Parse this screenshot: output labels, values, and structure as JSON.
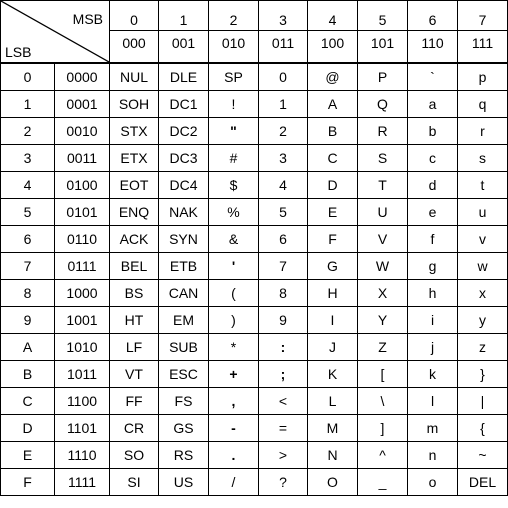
{
  "corner": {
    "msb_label": "MSB",
    "lsb_label": "LSB"
  },
  "columns": [
    {
      "hex": "0",
      "bin": "000"
    },
    {
      "hex": "1",
      "bin": "001"
    },
    {
      "hex": "2",
      "bin": "010"
    },
    {
      "hex": "3",
      "bin": "011"
    },
    {
      "hex": "4",
      "bin": "100"
    },
    {
      "hex": "5",
      "bin": "101"
    },
    {
      "hex": "6",
      "bin": "110"
    },
    {
      "hex": "7",
      "bin": "111"
    }
  ],
  "rows": [
    {
      "hex": "0",
      "bin": "0000",
      "cells": [
        "NUL",
        "DLE",
        "SP",
        "0",
        "@",
        "P",
        "`",
        "p"
      ]
    },
    {
      "hex": "1",
      "bin": "0001",
      "cells": [
        "SOH",
        "DC1",
        "!",
        "1",
        "A",
        "Q",
        "a",
        "q"
      ]
    },
    {
      "hex": "2",
      "bin": "0010",
      "cells": [
        "STX",
        "DC2",
        "\"",
        "2",
        "B",
        "R",
        "b",
        "r"
      ]
    },
    {
      "hex": "3",
      "bin": "0011",
      "cells": [
        "ETX",
        "DC3",
        "#",
        "3",
        "C",
        "S",
        "c",
        "s"
      ]
    },
    {
      "hex": "4",
      "bin": "0100",
      "cells": [
        "EOT",
        "DC4",
        "$",
        "4",
        "D",
        "T",
        "d",
        "t"
      ]
    },
    {
      "hex": "5",
      "bin": "0101",
      "cells": [
        "ENQ",
        "NAK",
        "%",
        "5",
        "E",
        "U",
        "e",
        "u"
      ]
    },
    {
      "hex": "6",
      "bin": "0110",
      "cells": [
        "ACK",
        "SYN",
        "&",
        "6",
        "F",
        "V",
        "f",
        "v"
      ]
    },
    {
      "hex": "7",
      "bin": "0111",
      "cells": [
        "BEL",
        "ETB",
        "'",
        "7",
        "G",
        "W",
        "g",
        "w"
      ]
    },
    {
      "hex": "8",
      "bin": "1000",
      "cells": [
        "BS",
        "CAN",
        "(",
        "8",
        "H",
        "X",
        "h",
        "x"
      ]
    },
    {
      "hex": "9",
      "bin": "1001",
      "cells": [
        "HT",
        "EM",
        ")",
        "9",
        "I",
        "Y",
        "i",
        "y"
      ]
    },
    {
      "hex": "A",
      "bin": "1010",
      "cells": [
        "LF",
        "SUB",
        "*",
        ":",
        "J",
        "Z",
        "j",
        "z"
      ]
    },
    {
      "hex": "B",
      "bin": "1011",
      "cells": [
        "VT",
        "ESC",
        "+",
        ";",
        "K",
        "[",
        "k",
        "}"
      ]
    },
    {
      "hex": "C",
      "bin": "1100",
      "cells": [
        "FF",
        "FS",
        ",",
        "<",
        "L",
        "\\",
        "l",
        "|"
      ]
    },
    {
      "hex": "D",
      "bin": "1101",
      "cells": [
        "CR",
        "GS",
        "-",
        "=",
        "M",
        "]",
        "m",
        "{"
      ]
    },
    {
      "hex": "E",
      "bin": "1110",
      "cells": [
        "SO",
        "RS",
        ".",
        ">",
        "N",
        "^",
        "n",
        "~"
      ]
    },
    {
      "hex": "F",
      "bin": "1111",
      "cells": [
        "SI",
        "US",
        "/",
        "?",
        "O",
        "_",
        "o",
        "DEL"
      ]
    }
  ]
}
